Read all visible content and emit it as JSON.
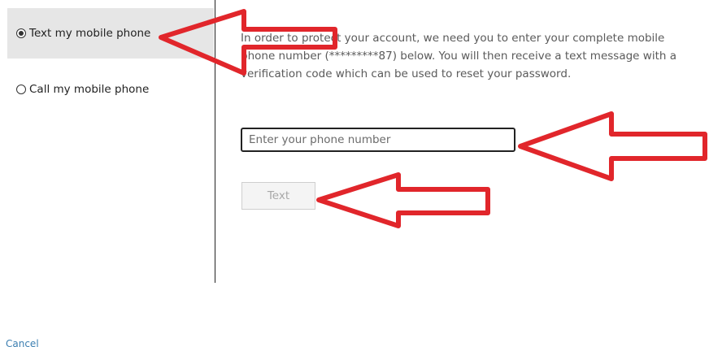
{
  "options": [
    {
      "label": "Text my mobile phone",
      "selected": true
    },
    {
      "label": "Call my mobile phone",
      "selected": false
    }
  ],
  "instructions": "In order to protect your account, we need you to enter your complete mobile phone number (*********87) below. You will then receive a text message with a verification code which can be used to reset your password.",
  "phone_input": {
    "placeholder": "Enter your phone number",
    "value": ""
  },
  "text_button_label": "Text",
  "cancel_label": "Cancel",
  "colors": {
    "annotation_arrow": "#e1262b",
    "selected_option_bg": "#e6e6e6",
    "link": "#3c7fb1",
    "disabled_button_text": "#a8a8a8"
  }
}
